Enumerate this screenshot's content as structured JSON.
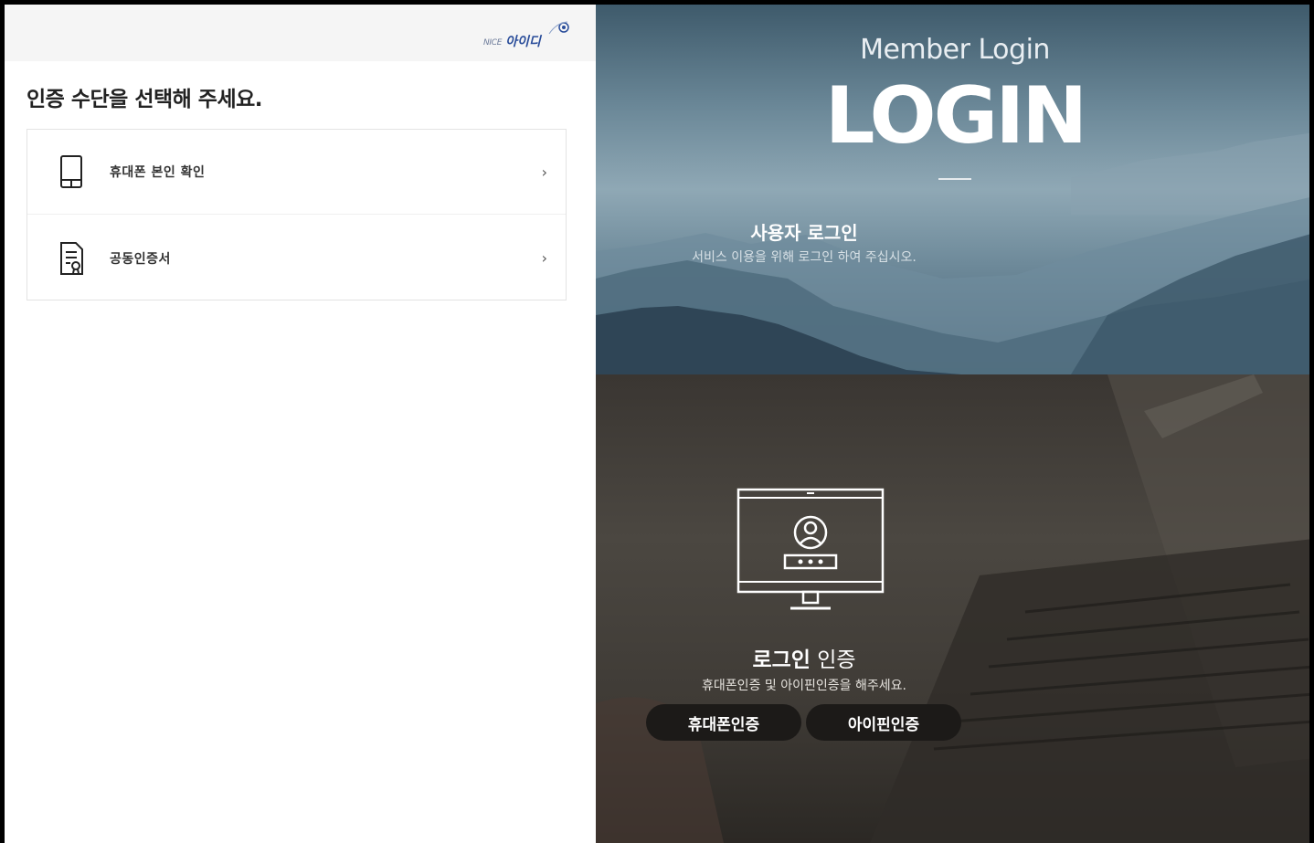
{
  "left": {
    "logo": {
      "small": "NICE",
      "main": "아이디"
    },
    "title": "인증 수단을 선택해 주세요.",
    "options": [
      {
        "label": "휴대폰 본인 확인",
        "icon": "mobile-phone-icon",
        "chevron": "›"
      },
      {
        "label": "공동인증서",
        "icon": "certificate-document-icon",
        "chevron": "›"
      }
    ]
  },
  "right": {
    "member_login": "Member Login",
    "login": "LOGIN",
    "user_login": "사용자 로그인",
    "user_login_sub": "서비스 이용을 위해 로그인 하여 주십시오.",
    "cert_title_bold": "로그인",
    "cert_title_rest": " 인증",
    "cert_sub": "휴대폰인증 및 아이핀인증을 해주세요.",
    "btn_phone": "휴대폰인증",
    "btn_ipin": "아이핀인증",
    "monitor_icon": "monitor-user-login-icon"
  },
  "colors": {
    "brand_blue": "#2a4d9a",
    "button_bg": "#1c1a18",
    "frame": "#000000"
  }
}
